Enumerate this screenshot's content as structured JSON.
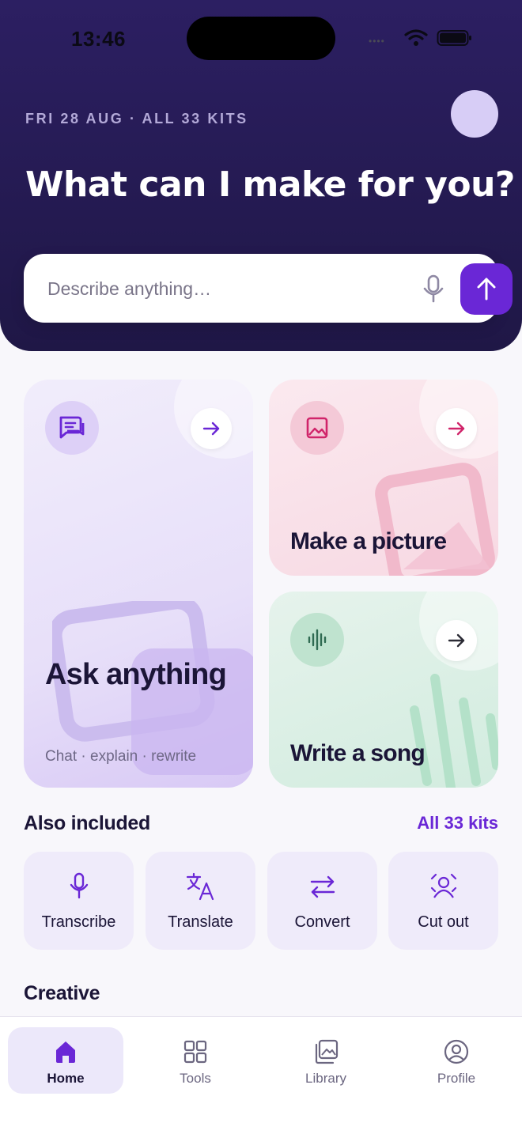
{
  "status_bar": {
    "time": "13:46"
  },
  "header": {
    "meta": "FRI 28 AUG  ·  ALL 33 KITS",
    "headline": "What can I make for you?"
  },
  "search": {
    "placeholder": "Describe anything…",
    "icons": [
      "mic-icon",
      "arrow-up-icon"
    ]
  },
  "cards": {
    "ask": {
      "title": "Ask anything",
      "subtitle": "Chat · explain · rewrite",
      "icon": "chat-icon"
    },
    "picture": {
      "title": "Make a picture",
      "icon": "image-icon"
    },
    "song": {
      "title": "Write a song",
      "icon": "waveform-icon"
    }
  },
  "also_included": {
    "heading": "Also included",
    "link": "All 33 kits",
    "tiles": [
      {
        "label": "Transcribe",
        "icon": "mic-icon"
      },
      {
        "label": "Translate",
        "icon": "translate-icon"
      },
      {
        "label": "Convert",
        "icon": "swap-icon"
      },
      {
        "label": "Cut out",
        "icon": "cutout-icon"
      }
    ]
  },
  "creative": {
    "heading": "Creative"
  },
  "nav": {
    "items": [
      {
        "label": "Home",
        "icon": "home-icon",
        "active": true
      },
      {
        "label": "Tools",
        "icon": "grid-icon"
      },
      {
        "label": "Library",
        "icon": "library-icon"
      },
      {
        "label": "Profile",
        "icon": "profile-icon"
      }
    ]
  },
  "colors": {
    "accent": "#6a27d6",
    "hero_bg": "#241a52",
    "ask_card": "#e7dff9",
    "picture_card": "#f7d9e3",
    "song_card": "#d2ecdf"
  }
}
